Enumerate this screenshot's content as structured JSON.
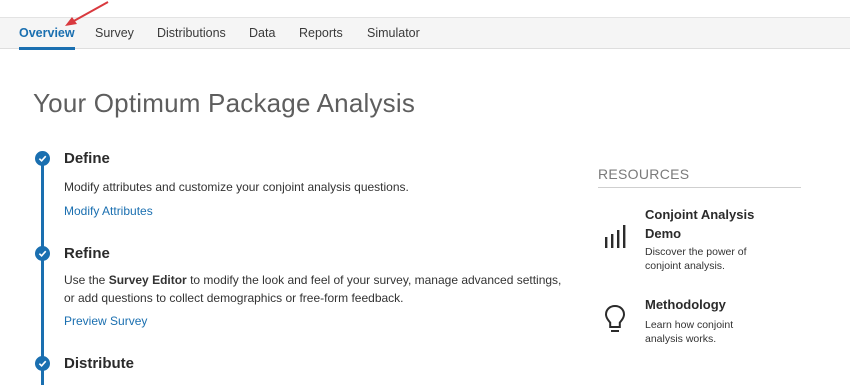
{
  "nav": {
    "tabs": [
      {
        "label": "Overview",
        "active": true
      },
      {
        "label": "Survey"
      },
      {
        "label": "Distributions"
      },
      {
        "label": "Data"
      },
      {
        "label": "Reports"
      },
      {
        "label": "Simulator"
      }
    ]
  },
  "page": {
    "title": "Your Optimum Package Analysis"
  },
  "steps": [
    {
      "title": "Define",
      "desc": "Modify attributes and customize your conjoint analysis questions.",
      "link": "Modify Attributes"
    },
    {
      "title": "Refine",
      "desc_bold": "Survey Editor",
      "desc_pre": "Use the ",
      "desc_post": " to modify the look and feel of your survey, manage advanced settings, or add questions to collect demographics or free-form feedback.",
      "link": "Preview Survey"
    },
    {
      "title": "Distribute"
    }
  ],
  "resources": {
    "heading": "RESOURCES",
    "items": [
      {
        "title": "Conjoint Analysis Demo",
        "desc": "Discover the power of conjoint analysis.",
        "icon": "bar-chart-icon"
      },
      {
        "title": "Methodology",
        "desc": "Learn how conjoint analysis works.",
        "icon": "lightbulb-icon"
      }
    ]
  },
  "colors": {
    "accent": "#1a6fb0",
    "annotation_arrow": "#d9393e"
  }
}
